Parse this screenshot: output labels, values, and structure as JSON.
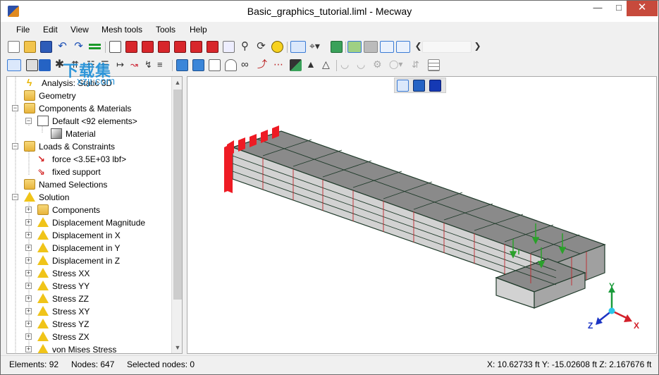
{
  "window": {
    "title": "Basic_graphics_tutorial.liml - Mecway"
  },
  "menu": [
    "File",
    "Edit",
    "View",
    "Mesh tools",
    "Tools",
    "Help"
  ],
  "watermark": {
    "line1": "下载集",
    "line2": "xzji.com"
  },
  "tree": {
    "items": [
      {
        "label": "Analysis: Static 3D",
        "icon": "lightning-icon"
      },
      {
        "label": "Geometry",
        "icon": "folder-icon"
      },
      {
        "label": "Components & Materials",
        "icon": "components-icon"
      },
      {
        "label": "Default <92 elements>",
        "icon": "component-icon"
      },
      {
        "label": "Material",
        "icon": "material-icon"
      },
      {
        "label": "Loads & Constraints",
        "icon": "loads-folder-icon"
      },
      {
        "label": "force <3.5E+03 lbf>",
        "icon": "force-icon"
      },
      {
        "label": "fixed support",
        "icon": "support-icon"
      },
      {
        "label": "Named Selections",
        "icon": "named-selections-icon"
      },
      {
        "label": "Solution",
        "icon": "solution-icon"
      },
      {
        "label": "Components",
        "icon": "components-icon"
      },
      {
        "label": "Displacement Magnitude",
        "icon": "result-icon"
      },
      {
        "label": "Displacement in X",
        "icon": "result-icon"
      },
      {
        "label": "Displacement in Y",
        "icon": "result-icon"
      },
      {
        "label": "Displacement in Z",
        "icon": "result-icon"
      },
      {
        "label": "Stress XX",
        "icon": "result-icon"
      },
      {
        "label": "Stress YY",
        "icon": "result-icon"
      },
      {
        "label": "Stress ZZ",
        "icon": "result-icon"
      },
      {
        "label": "Stress XY",
        "icon": "result-icon"
      },
      {
        "label": "Stress YZ",
        "icon": "result-icon"
      },
      {
        "label": "Stress ZX",
        "icon": "result-icon"
      },
      {
        "label": "von Mises Stress",
        "icon": "result-icon"
      }
    ]
  },
  "axes": {
    "x": "X",
    "y": "Y",
    "z": "Z"
  },
  "status": {
    "elements": "Elements: 92",
    "nodes": "Nodes: 647",
    "selected": "Selected nodes: 0",
    "coords": "X: 10.62733 ft Y: -15.02608 ft Z: 2.167676 ft"
  }
}
